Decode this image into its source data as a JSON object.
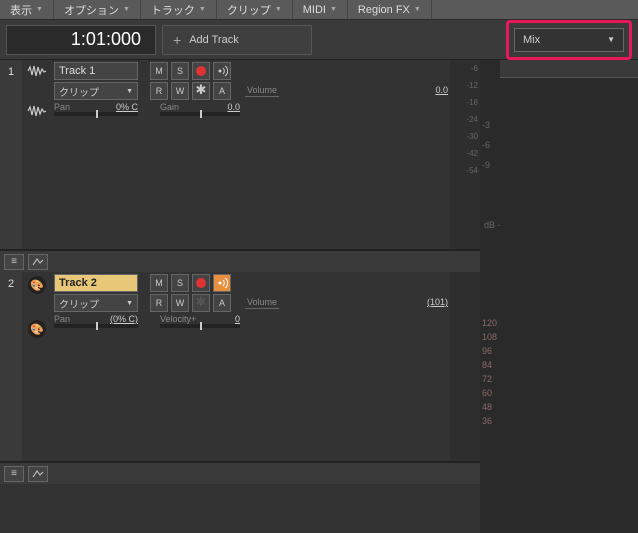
{
  "menu": {
    "items": [
      "表示",
      "オプション",
      "トラック",
      "クリップ",
      "MIDI",
      "Region FX"
    ]
  },
  "topbar": {
    "time": "1:01:000",
    "add_track": "Add Track",
    "mix_label": "Mix"
  },
  "tracks": [
    {
      "num": "1",
      "name": "Track 1",
      "selected": false,
      "clip_label": "クリップ",
      "buttons": {
        "m": "M",
        "s": "S",
        "r": "R",
        "w": "W",
        "a": "A"
      },
      "volume_label": "Volume",
      "volume_val": "0.0",
      "pan_label": "Pan",
      "pan_val": "0% C",
      "gain_label": "Gain",
      "gain_val": "0.0",
      "echo_on": false,
      "meters": [
        "-6",
        "-12",
        "-18",
        "-24",
        "-30",
        "-42",
        "-54"
      ]
    },
    {
      "num": "2",
      "name": "Track 2",
      "selected": true,
      "clip_label": "クリップ",
      "buttons": {
        "m": "M",
        "s": "S",
        "r": "R",
        "w": "W",
        "a": "A"
      },
      "volume_label": "Volume",
      "volume_val": "(101)",
      "pan_label": "Pan",
      "pan_val": "(0% C)",
      "gain_label": "Velocity+",
      "gain_val": "0",
      "echo_on": true,
      "meters": []
    }
  ],
  "timeline": {
    "scale": [
      "-3",
      "-6",
      "-9",
      ""
    ],
    "db_label": "dB -",
    "rows": [
      "120",
      "108",
      "96",
      "84",
      "72",
      "60",
      "48",
      "36"
    ]
  }
}
